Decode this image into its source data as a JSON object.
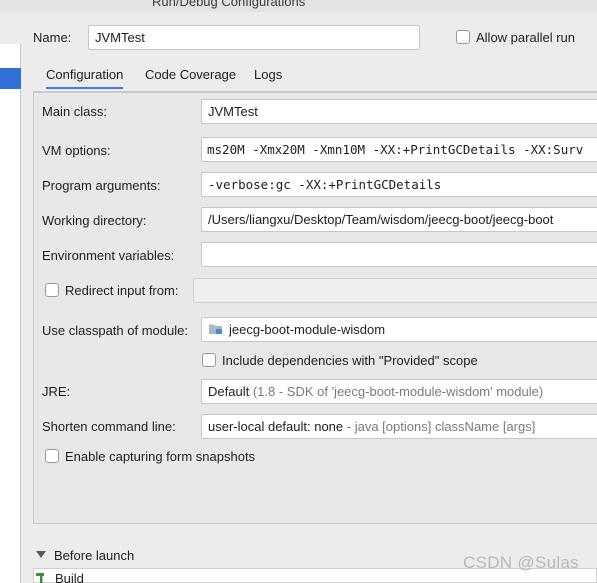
{
  "window": {
    "title": "Run/Debug Configurations"
  },
  "header": {
    "name_label": "Name:",
    "name_value": "JVMTest",
    "allow_parallel_label": "Allow parallel run"
  },
  "tabs": [
    {
      "label": "Configuration"
    },
    {
      "label": "Code Coverage"
    },
    {
      "label": "Logs"
    }
  ],
  "form": {
    "main_class_label": "Main class:",
    "main_class_value": "JVMTest",
    "vm_options_label": "VM options:",
    "vm_options_value": "ms20M -Xmx20M -Xmn10M -XX:+PrintGCDetails -XX:Surv",
    "program_args_label": "Program arguments:",
    "program_args_value": "-verbose:gc -XX:+PrintGCDetails",
    "working_dir_label": "Working directory:",
    "working_dir_value": "/Users/liangxu/Desktop/Team/wisdom/jeecg-boot/jeecg-boot",
    "env_vars_label": "Environment variables:",
    "env_vars_value": "",
    "redirect_input_label": "Redirect input from:",
    "classpath_label": "Use classpath of module:",
    "classpath_value": "jeecg-boot-module-wisdom",
    "include_deps_label": "Include dependencies with \"Provided\" scope",
    "jre_label": "JRE:",
    "jre_value": "Default",
    "jre_hint": "(1.8 - SDK of 'jeecg-boot-module-wisdom' module)",
    "shorten_label": "Shorten command line:",
    "shorten_value": "user-local default: none",
    "shorten_hint": "- java [options] className [args]",
    "snapshots_label": "Enable capturing form snapshots"
  },
  "before_launch": {
    "label": "Before launch",
    "items": [
      {
        "label": "Build"
      }
    ]
  },
  "watermark": "CSDN @Sulas",
  "colors": {
    "accent": "#3d7ce8",
    "selection": "#2f6fd6"
  }
}
